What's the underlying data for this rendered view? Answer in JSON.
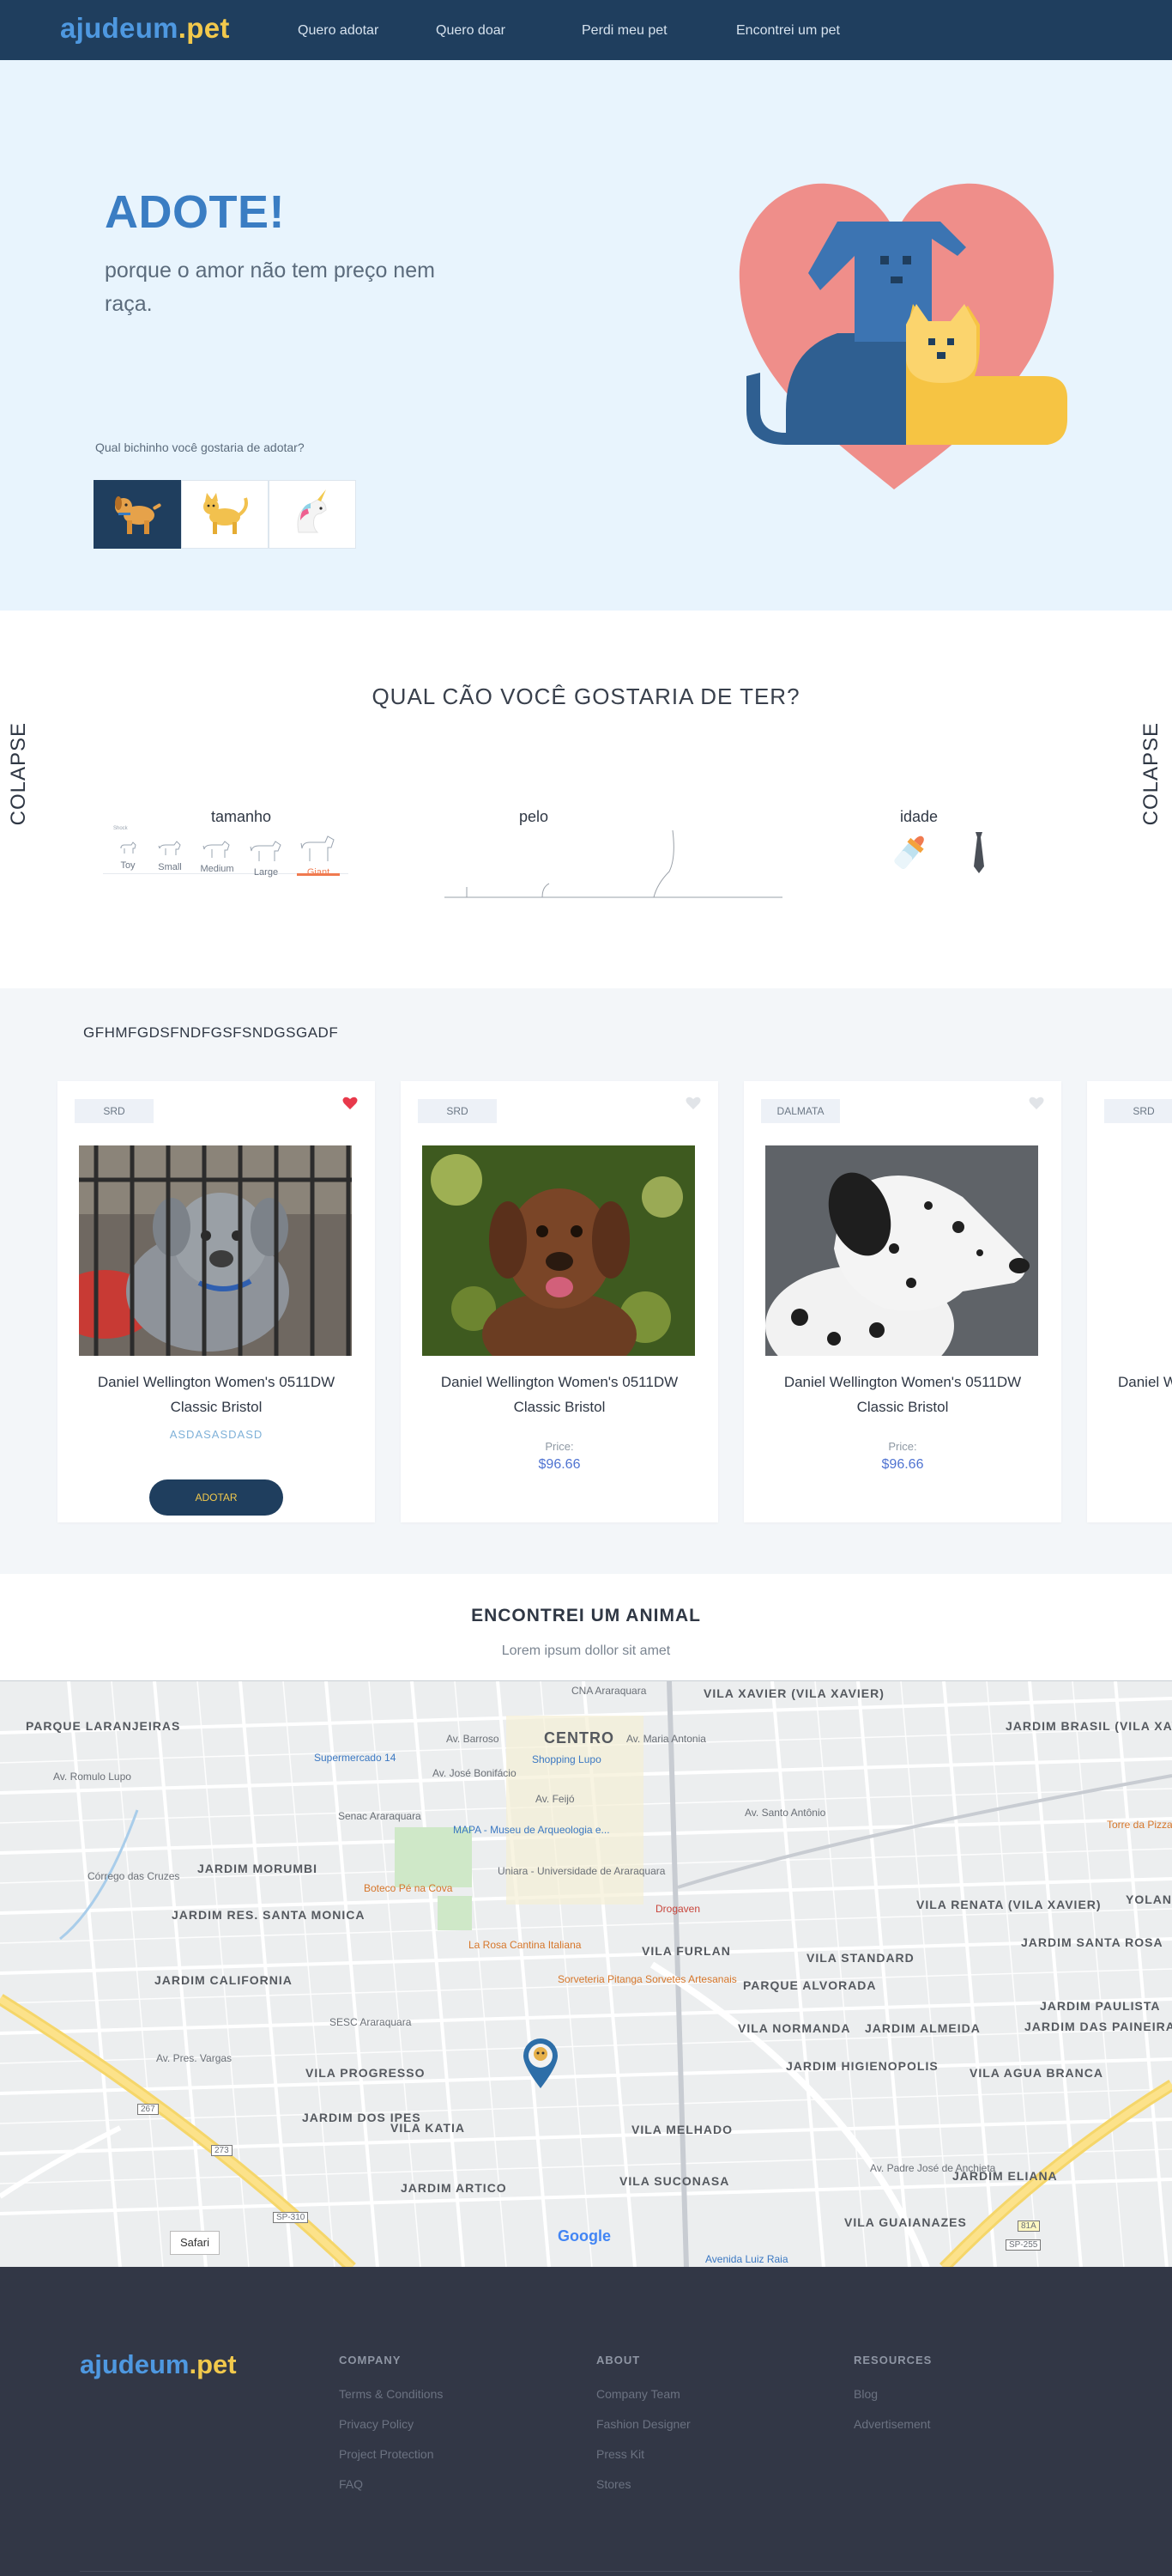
{
  "nav": {
    "logo_main": "ajudeum",
    "logo_suffix": ".pet",
    "links": [
      "Quero adotar",
      "Quero doar",
      "Perdi meu pet",
      "Encontrei um pet"
    ]
  },
  "hero": {
    "title": "ADOTE!",
    "tagline": "porque o amor não tem preço nem raça.",
    "question": "Qual bichinho você gostaria de adotar?",
    "types": [
      {
        "icon": "dog-icon",
        "active": true
      },
      {
        "icon": "cat-icon",
        "active": false
      },
      {
        "icon": "unicorn-icon",
        "active": false
      }
    ]
  },
  "filters": {
    "title": "QUAL CÃO VOCÊ GOSTARIA DE TER?",
    "colapse_left": "COLAPSE",
    "colapse_right": "COLAPSE",
    "size_label": "tamanho",
    "size_small_label": "Shock",
    "sizes": [
      "Toy",
      "Small",
      "Medium",
      "Large",
      "Giant"
    ],
    "selected_size": "Giant",
    "fur_label": "pelo",
    "age_label": "idade"
  },
  "cards_section": {
    "title": "GFHMFGDSFNDFGSFSNDGSGADF",
    "cards": [
      {
        "tag": "SRD",
        "favorite": true,
        "name": "Daniel Wellington Women's 0511DW Classic Bristol",
        "breed": "ASDASASDASD",
        "button": "ADOTAR"
      },
      {
        "tag": "SRD",
        "favorite": false,
        "name": "Daniel Wellington Women's 0511DW Classic Bristol",
        "price_label": "Price:",
        "price": "$96.66"
      },
      {
        "tag": "DALMATA",
        "favorite": false,
        "name": "Daniel Wellington Women's 0511DW Classic Bristol",
        "price_label": "Price:",
        "price": "$96.66"
      },
      {
        "tag": "SRD",
        "name": "Daniel W"
      }
    ]
  },
  "found": {
    "title": "ENCONTREI UM ANIMAL",
    "subtitle": "Lorem ipsum dollor sit amet"
  },
  "map": {
    "labels": [
      "PARQUE LARANJEIRAS",
      "CENTRO",
      "JARDIM MORUMBI",
      "JARDIM RES. SANTA MONICA",
      "JARDIM CALIFORNIA",
      "VILA PROGRESSO",
      "JARDIM DOS IPES",
      "VILA KATIA",
      "JARDIM ARTICO",
      "VILA FURLAN",
      "VILA STANDARD",
      "PARQUE ALVORADA",
      "VILA NORMANDA",
      "JARDIM HIGIENOPOLIS",
      "VILA MELHADO",
      "VILA SUCONASA",
      "JARDIM ALMEIDA",
      "VILA XAVIER (VILA XAVIER)",
      "JARDIM BRASIL (VILA XAVIER)",
      "VILA RENATA (VILA XAVIER)",
      "JARDIM SANTA ROSA",
      "JARDIM PAULISTA",
      "JARDIM DAS PAINEIRAS",
      "VILA AGUA BRANCA",
      "JARDIM ELIANA",
      "VILA GUAIANAZES",
      "YOLANDA"
    ],
    "pois": [
      "Supermercado 14",
      "Shopping Lupo",
      "Senac Araraquara",
      "MAPA - Museu de Arqueologia e...",
      "Uniara - Universidade de Araraquara",
      "Boteco Pé na Cova",
      "Drogaven",
      "La Rosa Cantina Italiana",
      "Sorveteria Pitanga Sorvetes Artesanais",
      "SESC Araraquara",
      "Torre da Pizza",
      "CNA Araraquara"
    ],
    "streets": [
      "Av. Barroso",
      "Av. José Bonifácio",
      "Av. Feijó",
      "Av. Santo Antônio",
      "Av. Pres. Vargas",
      "Av. Padre José de Anchieta",
      "Córrego das Cruzes",
      "Av. Maria Antonia",
      "Av. Romulo Lupo",
      "Avenida Luiz Raia"
    ],
    "road_badges": [
      "SP-310",
      "SP-255",
      "273",
      "267",
      "81A"
    ],
    "safari_label": "Safari",
    "google_label": "Google"
  },
  "footer": {
    "logo_main": "ajudeum",
    "logo_suffix": ".pet",
    "columns": [
      {
        "title": "COMPANY",
        "links": [
          "Terms & Conditions",
          "Privacy Policy",
          "Project Protection",
          "FAQ"
        ]
      },
      {
        "title": "ABOUT",
        "links": [
          "Company Team",
          "Fashion Designer",
          "Press Kit",
          "Stores"
        ]
      },
      {
        "title": "RESOURCES",
        "links": [
          "Blog",
          "Advertisement"
        ]
      }
    ]
  },
  "colors": {
    "navy": "#1f3e5e",
    "brand_blue": "#4e98e0",
    "brand_yellow": "#f2c94c",
    "hero_bg": "#e8f4fd",
    "accent_orange": "#f07a4f",
    "favorite_red": "#e8394b",
    "footer_bg": "#323746"
  }
}
